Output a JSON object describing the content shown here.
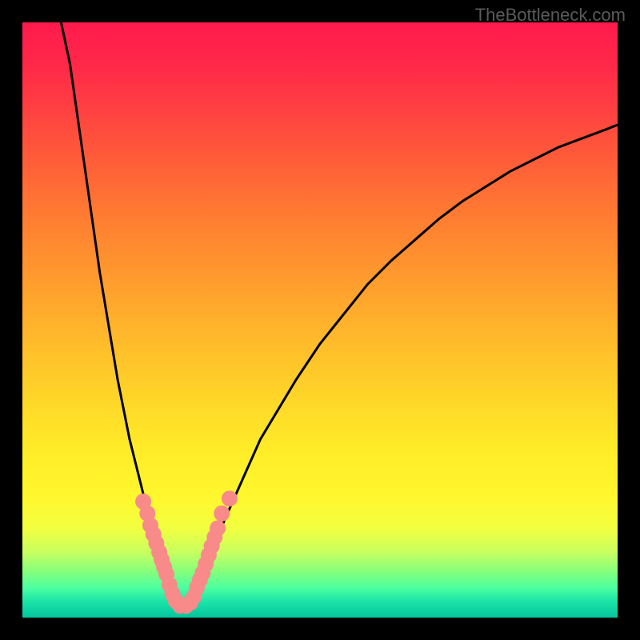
{
  "watermark": "TheBottleneck.com",
  "chart_data": {
    "type": "line",
    "title": "",
    "xlabel": "",
    "ylabel": "",
    "xlim": [
      0,
      100
    ],
    "ylim": [
      0,
      100
    ],
    "curve_left": {
      "name": "left-branch",
      "x": [
        6.5,
        8,
        9,
        10,
        11,
        12,
        13,
        14,
        15,
        16,
        17,
        18,
        19,
        20,
        21,
        22,
        22.8,
        23.5,
        24.2,
        24.8,
        25.5,
        26,
        26.5,
        27
      ],
      "y": [
        100,
        93,
        86,
        79,
        72,
        65,
        58,
        52,
        46,
        40,
        35,
        30,
        26,
        22,
        18,
        15,
        12,
        10,
        8,
        6.5,
        5,
        3.8,
        2.8,
        2
      ]
    },
    "curve_right": {
      "name": "right-branch",
      "x": [
        27,
        28,
        29,
        30,
        31,
        32,
        33,
        34,
        36,
        38,
        40,
        43,
        46,
        50,
        54,
        58,
        62,
        66,
        70,
        74,
        78,
        82,
        86,
        90,
        94,
        98,
        100
      ],
      "y": [
        2,
        3,
        4.5,
        6.5,
        9,
        11.5,
        14,
        16.5,
        21,
        25.5,
        30,
        35,
        40,
        46,
        51,
        56,
        60,
        63.5,
        67,
        70,
        72.5,
        75,
        77,
        79,
        80.5,
        82,
        82.8
      ]
    },
    "dots": [
      {
        "x": 20.3,
        "y": 19.5
      },
      {
        "x": 21.0,
        "y": 17.5
      },
      {
        "x": 21.5,
        "y": 15.5
      },
      {
        "x": 22.0,
        "y": 14.0
      },
      {
        "x": 22.5,
        "y": 12.5
      },
      {
        "x": 23.0,
        "y": 11.0
      },
      {
        "x": 23.4,
        "y": 9.7
      },
      {
        "x": 23.8,
        "y": 8.5
      },
      {
        "x": 24.2,
        "y": 7.3
      },
      {
        "x": 24.7,
        "y": 5.5
      },
      {
        "x": 25.2,
        "y": 4.0
      },
      {
        "x": 25.8,
        "y": 2.8
      },
      {
        "x": 26.5,
        "y": 2.0
      },
      {
        "x": 27.5,
        "y": 2.0
      },
      {
        "x": 28.2,
        "y": 2.5
      },
      {
        "x": 28.8,
        "y": 3.5
      },
      {
        "x": 29.3,
        "y": 5.0
      },
      {
        "x": 29.8,
        "y": 6.3
      },
      {
        "x": 30.3,
        "y": 7.5
      },
      {
        "x": 30.8,
        "y": 9.0
      },
      {
        "x": 31.3,
        "y": 10.5
      },
      {
        "x": 31.8,
        "y": 12.0
      },
      {
        "x": 32.3,
        "y": 13.5
      },
      {
        "x": 32.8,
        "y": 15.0
      },
      {
        "x": 33.5,
        "y": 17.5
      },
      {
        "x": 34.8,
        "y": 20.0
      }
    ],
    "dot_color": "#f88a8a",
    "curve_color": "#000000",
    "gradient": {
      "top": "#ff1a4d",
      "mid": "#ffe028",
      "bottom": "#06c49a"
    }
  }
}
